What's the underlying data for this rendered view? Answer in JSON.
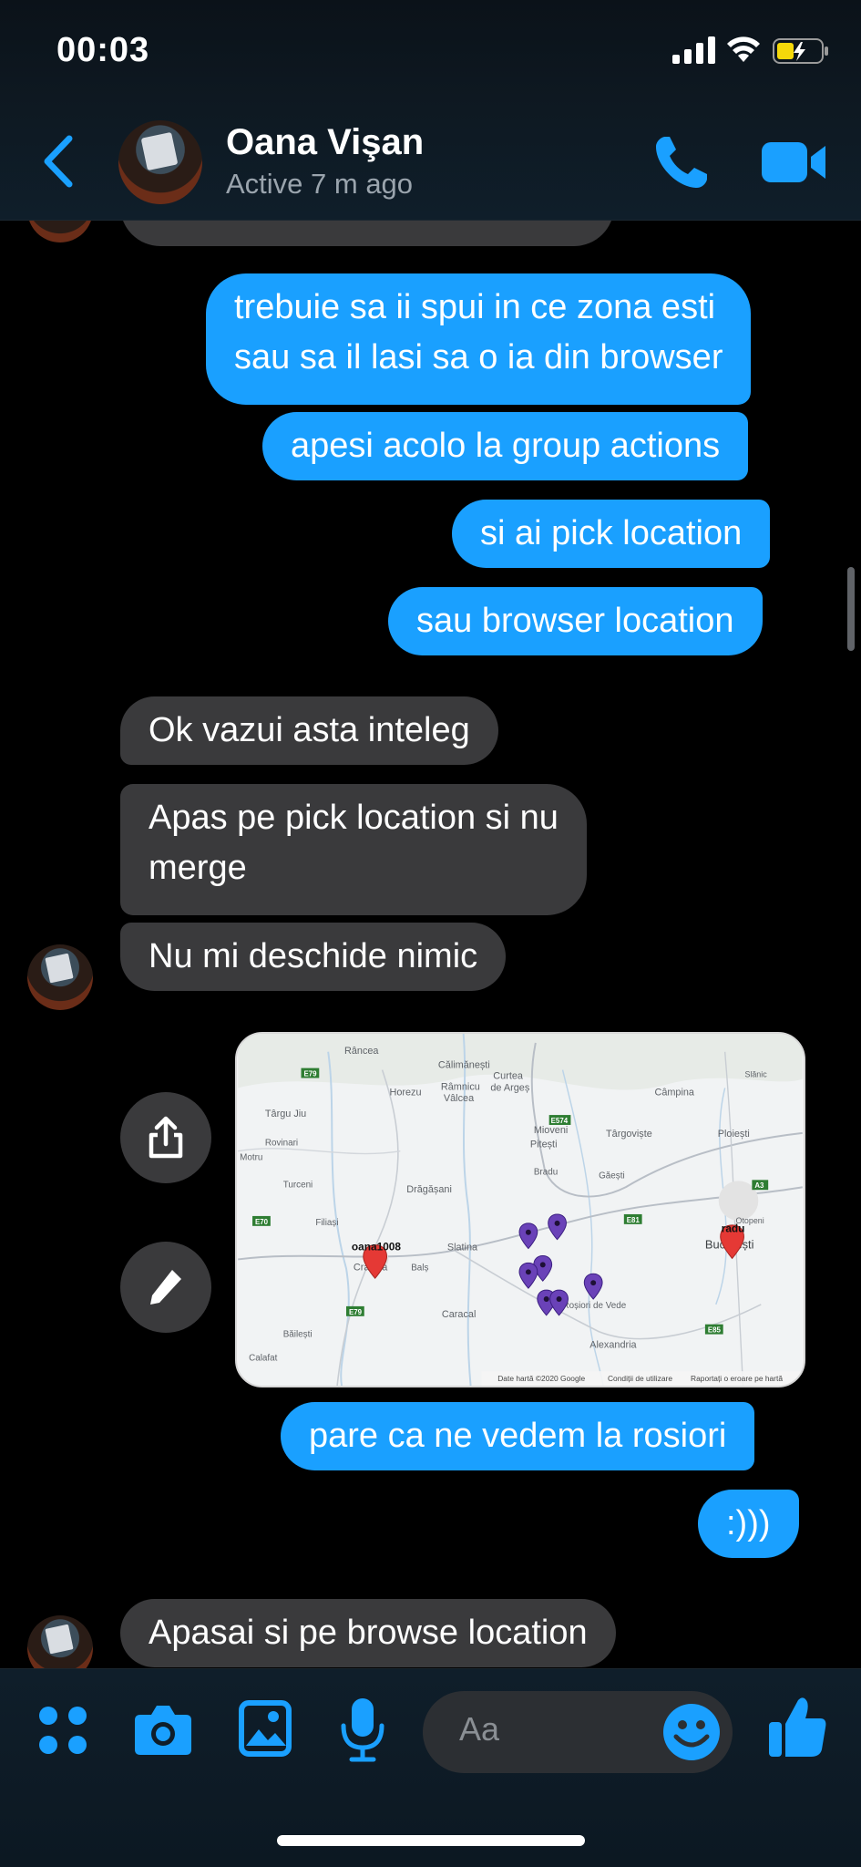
{
  "status_bar": {
    "time": "00:03"
  },
  "header": {
    "contact_name": "Oana Vişan",
    "contact_status": "Active 7 m ago"
  },
  "messages": [
    {
      "side": "out",
      "text_lines": [
        "trebuie sa ii spui in ce zona esti",
        "sau sa il lasi sa o ia din browser"
      ]
    },
    {
      "side": "out",
      "text": "apesi acolo la group actions"
    },
    {
      "side": "out",
      "text": "si ai pick location"
    },
    {
      "side": "out",
      "text": "sau browser location"
    },
    {
      "side": "in",
      "text": "Ok vazui asta inteleg"
    },
    {
      "side": "in",
      "text_lines": [
        "Apas pe pick location si nu",
        "merge"
      ]
    },
    {
      "side": "in",
      "text": "Nu mi deschide nimic"
    },
    {
      "side": "out",
      "text": "pare ca ne vedem la rosiori"
    },
    {
      "side": "out",
      "text": ":)))"
    },
    {
      "side": "in",
      "text": "Apasai si pe browse location"
    }
  ],
  "map": {
    "labels": {
      "rancea": "Râncea",
      "calimanesti": "Călimănești",
      "curtea": "Curtea",
      "de_arges": "de Argeș",
      "horezu": "Horezu",
      "ramnicu": "Râmnicu",
      "valcea": "Vâlcea",
      "campina": "Câmpina",
      "targu_jiu": "Târgu Jiu",
      "mioveni": "Mioveni",
      "pitesti": "Pitești",
      "targoviste": "Târgoviște",
      "ploiesti": "Ploiești",
      "slanic": "Slănic",
      "rovinari": "Rovinari",
      "motru": "Motru",
      "dragasani": "Drăgășani",
      "bradu": "Bradu",
      "gaesti": "Găești",
      "turceni": "Turceni",
      "filiasi": "Filiași",
      "slatina": "Slatina",
      "otopeni": "Otopeni",
      "bucuresti": "București",
      "craiova": "Craiova",
      "bals": "Balș",
      "caracal": "Caracal",
      "rosiori": "Roșiori de Vede",
      "alexandria": "Alexandria",
      "bailesti": "Băilești",
      "calafat": "Calafat",
      "pin_oana": "oana1008",
      "pin_radu": "radu",
      "road_e79": "E79",
      "road_e70": "E70",
      "road_e574": "E574",
      "road_e81": "E81",
      "road_a3": "A3",
      "road_e85": "E85",
      "footer_data": "Date hartă ©2020 Google",
      "footer_terms": "Condiții de utilizare",
      "footer_report": "Raportați o eroare pe hartă"
    }
  },
  "composer": {
    "placeholder": "Aa"
  },
  "colors": {
    "accent": "#1aa0ff",
    "incoming_bubble": "#3a3a3c",
    "background": "#000000",
    "pin_red": "#e53935",
    "pin_purple": "#7e57c2"
  }
}
